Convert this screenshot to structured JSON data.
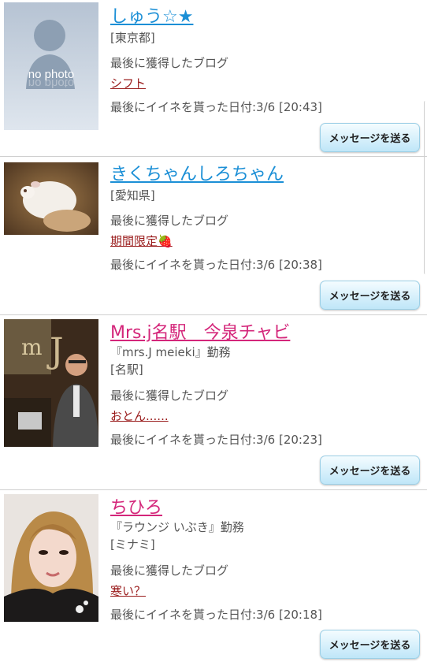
{
  "labels": {
    "last_blog": "最後に獲得したブログ",
    "message_button": "メッセージを送る"
  },
  "entries": [
    {
      "name": "しゅう☆★",
      "workplace": "",
      "area": "[東京都]",
      "blog_title": "シフト",
      "last_like": "最後にイイネを貰った日付:3/6 [20:43]",
      "photo_placeholder": "no photo"
    },
    {
      "name": "きくちゃんしろちゃん",
      "workplace": "",
      "area": "[愛知県]",
      "blog_title": "期間限定🍓",
      "last_like": "最後にイイネを貰った日付:3/6 [20:38]"
    },
    {
      "name": "Mrs.j名駅　今泉チャビ",
      "workplace": "『mrs.J meieki』勤務",
      "area": "[名駅]",
      "blog_title": "おとん......",
      "last_like": "最後にイイネを貰った日付:3/6 [20:23]"
    },
    {
      "name": "ちひろ",
      "workplace": "『ラウンジ いぶき』勤務",
      "area": "[ミナミ]",
      "blog_title": "寒い？",
      "last_like": "最後にイイネを貰った日付:3/6 [20:18]"
    }
  ],
  "colors": {
    "male_name": "#1b8fd6",
    "female_name": "#d4267a",
    "blog_link": "#9a1c1c",
    "button_top": "#f4fcff",
    "button_bottom": "#bfe6f8"
  }
}
